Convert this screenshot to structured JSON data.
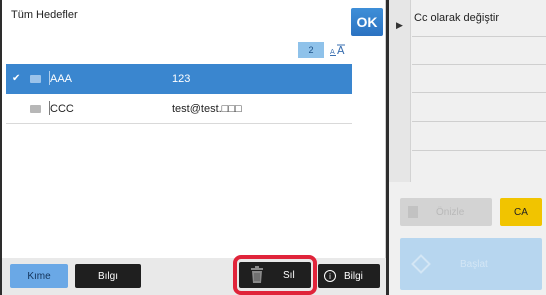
{
  "main": {
    "title": "Tüm Hedefler",
    "ok_label": "OK",
    "count": "2",
    "sort_icon": "sort-az-icon",
    "rows": [
      {
        "name": "AAA",
        "address": "123",
        "selected": true
      },
      {
        "name": "CCC",
        "address": "test@test.□□□",
        "selected": false
      }
    ]
  },
  "bottom": {
    "kime_label": "Kıme",
    "bilgi_left_label": "Bılgı",
    "sil_label": "Sıl",
    "bilgi_right_label": "Bilgi"
  },
  "right": {
    "title": "Cc olarak değiştir",
    "onizle_label": "Önizle",
    "ca_label": "CA",
    "baslat_label": "Başlat"
  },
  "colors": {
    "accent": "#3a86cf",
    "highlight_border": "#e0243a",
    "ca_button": "#f1c400"
  }
}
